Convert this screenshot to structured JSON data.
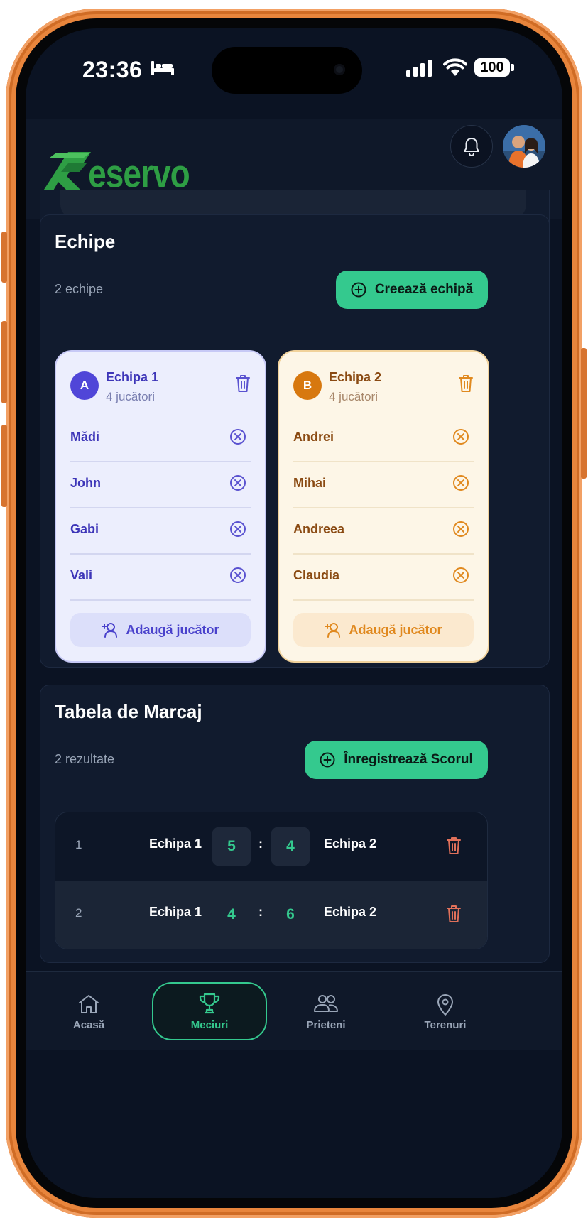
{
  "status": {
    "time": "23:36",
    "battery": "100"
  },
  "header": {
    "logo_text": "Reservo"
  },
  "teams_card": {
    "title": "Echipe",
    "count": "2 echipe",
    "create_label": "Creează echipă",
    "teams": [
      {
        "badge": "A",
        "name": "Echipa 1",
        "count": "4 jucători",
        "players": [
          "Mădi",
          "John",
          "Gabi",
          "Vali"
        ],
        "add_label": "Adaugă jucător",
        "accent": "#5046d8"
      },
      {
        "badge": "B",
        "name": "Echipa 2",
        "count": "4 jucători",
        "players": [
          "Andrei",
          "Mihai",
          "Andreea",
          "Claudia"
        ],
        "add_label": "Adaugă jucător",
        "accent": "#d7780f"
      }
    ]
  },
  "score_card": {
    "title": "Tabela de Marcaj",
    "count": "2 rezultate",
    "register_label": "Înregistrează Scorul",
    "rows": [
      {
        "index": "1",
        "team1": "Echipa 1",
        "score1": "5",
        "sep": ":",
        "score2": "4",
        "team2": "Echipa 2"
      },
      {
        "index": "2",
        "team1": "Echipa 1",
        "score1": "4",
        "sep": ":",
        "score2": "6",
        "team2": "Echipa 2"
      }
    ]
  },
  "nav": {
    "items": [
      {
        "label": "Acasă",
        "icon": "home-icon"
      },
      {
        "label": "Meciuri",
        "icon": "trophy-icon"
      },
      {
        "label": "Prieteni",
        "icon": "friends-icon"
      },
      {
        "label": "Terenuri",
        "icon": "location-pin-icon"
      }
    ],
    "active": "Meciuri"
  },
  "colors": {
    "accent_green": "#34c98e",
    "background": "#0b1323",
    "card": "#111b2e",
    "delete_red": "#e0705a"
  }
}
